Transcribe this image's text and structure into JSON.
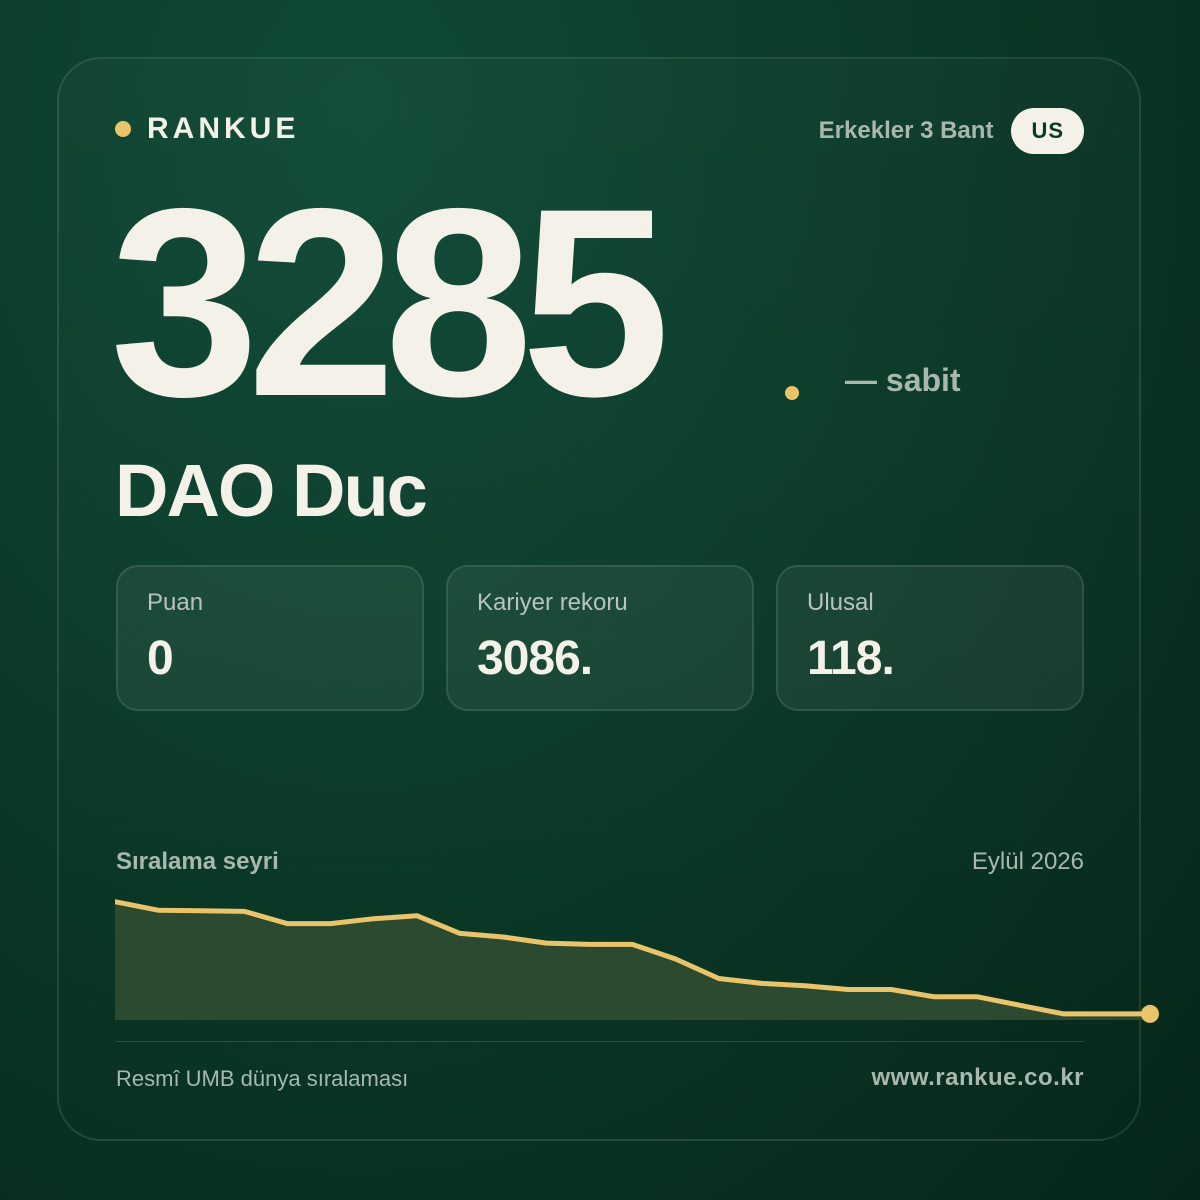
{
  "brand": {
    "name": "RANKUE",
    "dot_color": "#e9c46a"
  },
  "category": {
    "label": "Erkekler 3 Bant",
    "country": "US"
  },
  "rank": {
    "number": "3285",
    "trend": "— sabit"
  },
  "player": {
    "name": "DAO Duc"
  },
  "stats": [
    {
      "label": "Puan",
      "value": "0"
    },
    {
      "label": "Kariyer rekoru",
      "value": "3086."
    },
    {
      "label": "Ulusal",
      "value": "118."
    }
  ],
  "chart": {
    "title": "Sıralama seyri",
    "date": "Eylül 2026"
  },
  "chart_data": {
    "type": "area",
    "values": [
      0.97,
      0.9,
      0.895,
      0.89,
      0.79,
      0.79,
      0.83,
      0.855,
      0.71,
      0.68,
      0.63,
      0.62,
      0.62,
      0.5,
      0.34,
      0.3,
      0.28,
      0.25,
      0.25,
      0.19,
      0.19,
      0.12,
      0.05,
      0.05,
      0.05
    ],
    "line_color": "#e9c46a",
    "fill_color": "#2b4a30"
  },
  "footer": {
    "left": "Resmî UMB dünya sıralaması",
    "right": "www.rankue.co.kr"
  }
}
